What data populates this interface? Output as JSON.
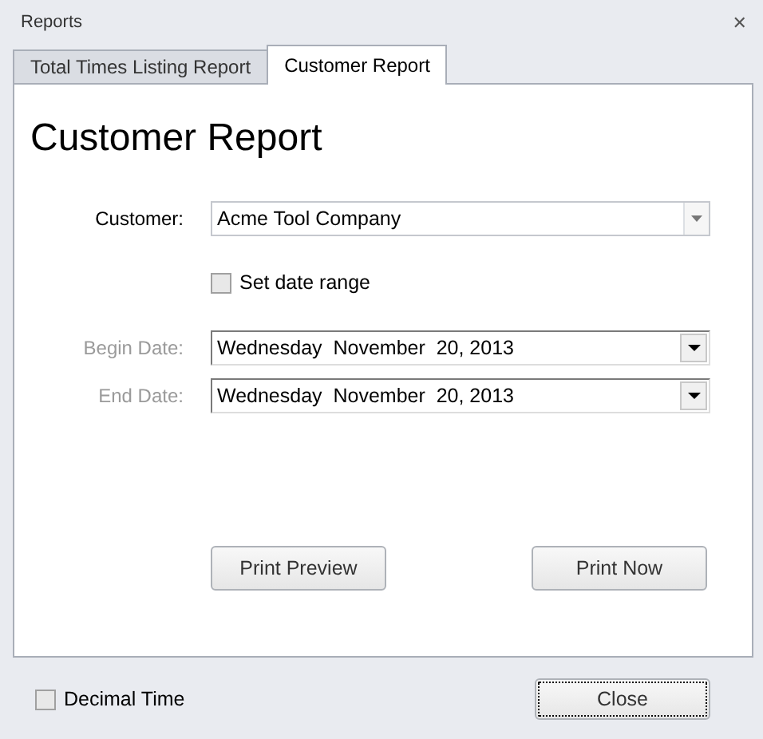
{
  "window": {
    "title": "Reports",
    "close_glyph": "✕"
  },
  "tabs": [
    {
      "label": "Total Times Listing Report",
      "selected": false
    },
    {
      "label": "Customer Report",
      "selected": true
    }
  ],
  "heading": "Customer Report",
  "customer": {
    "label": "Customer:",
    "value": "Acme Tool Company"
  },
  "date_range": {
    "label": "Set date range",
    "checked": false
  },
  "dates": [
    {
      "label": "Begin Date:",
      "value": "Wednesday  November  20, 2013",
      "disabled": true
    },
    {
      "label": "End Date:",
      "value": "Wednesday  November  20, 2013",
      "disabled": true
    }
  ],
  "actions": [
    "Print Preview",
    "Print Now"
  ],
  "decimal_time": {
    "label": "Decimal Time",
    "checked": false
  },
  "close_button": {
    "label": "Close",
    "focused": true
  }
}
